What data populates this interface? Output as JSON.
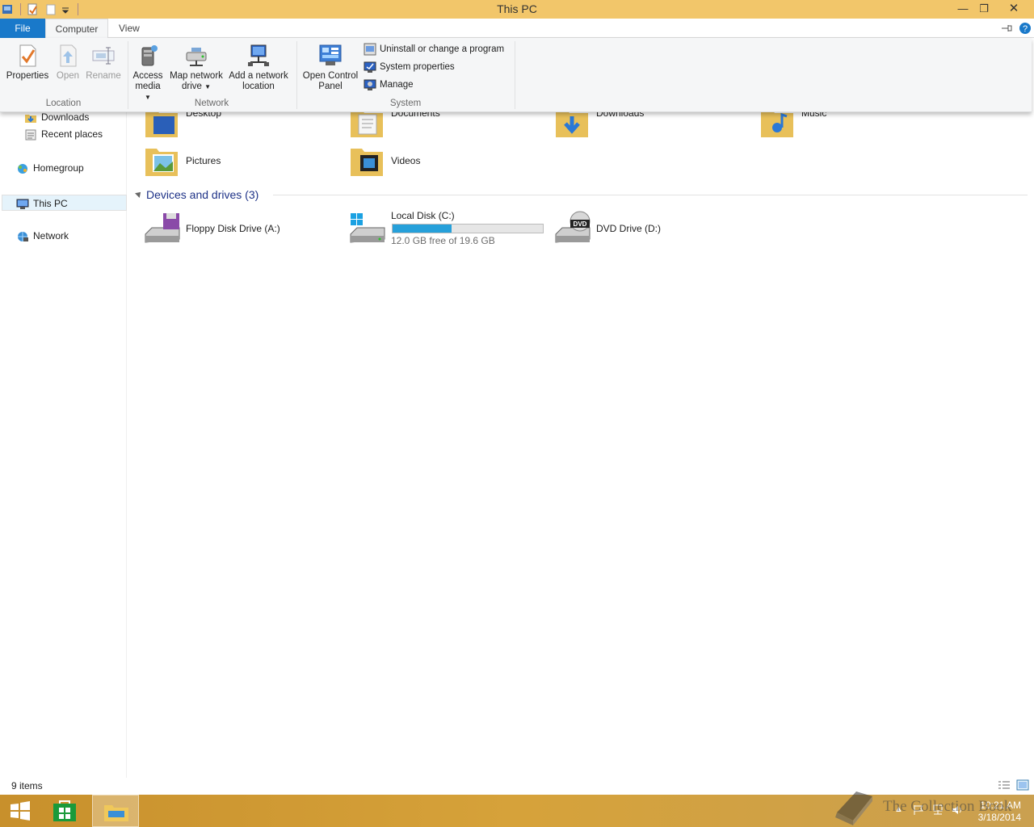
{
  "window": {
    "title": "This PC"
  },
  "tabs": {
    "file": "File",
    "computer": "Computer",
    "view": "View"
  },
  "ribbon": {
    "location": {
      "label": "Location",
      "properties": "Properties",
      "open": "Open",
      "rename": "Rename"
    },
    "network": {
      "label": "Network",
      "access_media": [
        "Access",
        "media"
      ],
      "map_drive": [
        "Map network",
        "drive"
      ],
      "add_location": [
        "Add a network",
        "location"
      ]
    },
    "system": {
      "label": "System",
      "open_control_panel": [
        "Open Control",
        "Panel"
      ],
      "uninstall": "Uninstall or change a program",
      "system_properties": "System properties",
      "manage": "Manage"
    }
  },
  "nav": {
    "items": [
      {
        "label": "Downloads"
      },
      {
        "label": "Recent places"
      },
      {
        "label": "Homegroup"
      },
      {
        "label": "This PC"
      },
      {
        "label": "Network"
      }
    ]
  },
  "folders": [
    {
      "label": "Desktop"
    },
    {
      "label": "Documents"
    },
    {
      "label": "Downloads"
    },
    {
      "label": "Music"
    },
    {
      "label": "Pictures"
    },
    {
      "label": "Videos"
    }
  ],
  "devices": {
    "header": "Devices and drives (3)",
    "floppy": "Floppy Disk Drive (A:)",
    "local_disk": {
      "label": "Local Disk (C:)",
      "free": "12.0 GB free of 19.6 GB",
      "used_fraction": 0.39
    },
    "dvd": "DVD Drive (D:)"
  },
  "status": {
    "items": "9 items"
  },
  "taskbar": {
    "date": "3/18/2014",
    "time": "10:21 AM",
    "watermark": "The Collection Book"
  },
  "colors": {
    "title_bar": "#f2c66a",
    "file_tab": "#1979ca",
    "accent_blue": "#26a0da",
    "taskbar": "#d6a23a"
  }
}
